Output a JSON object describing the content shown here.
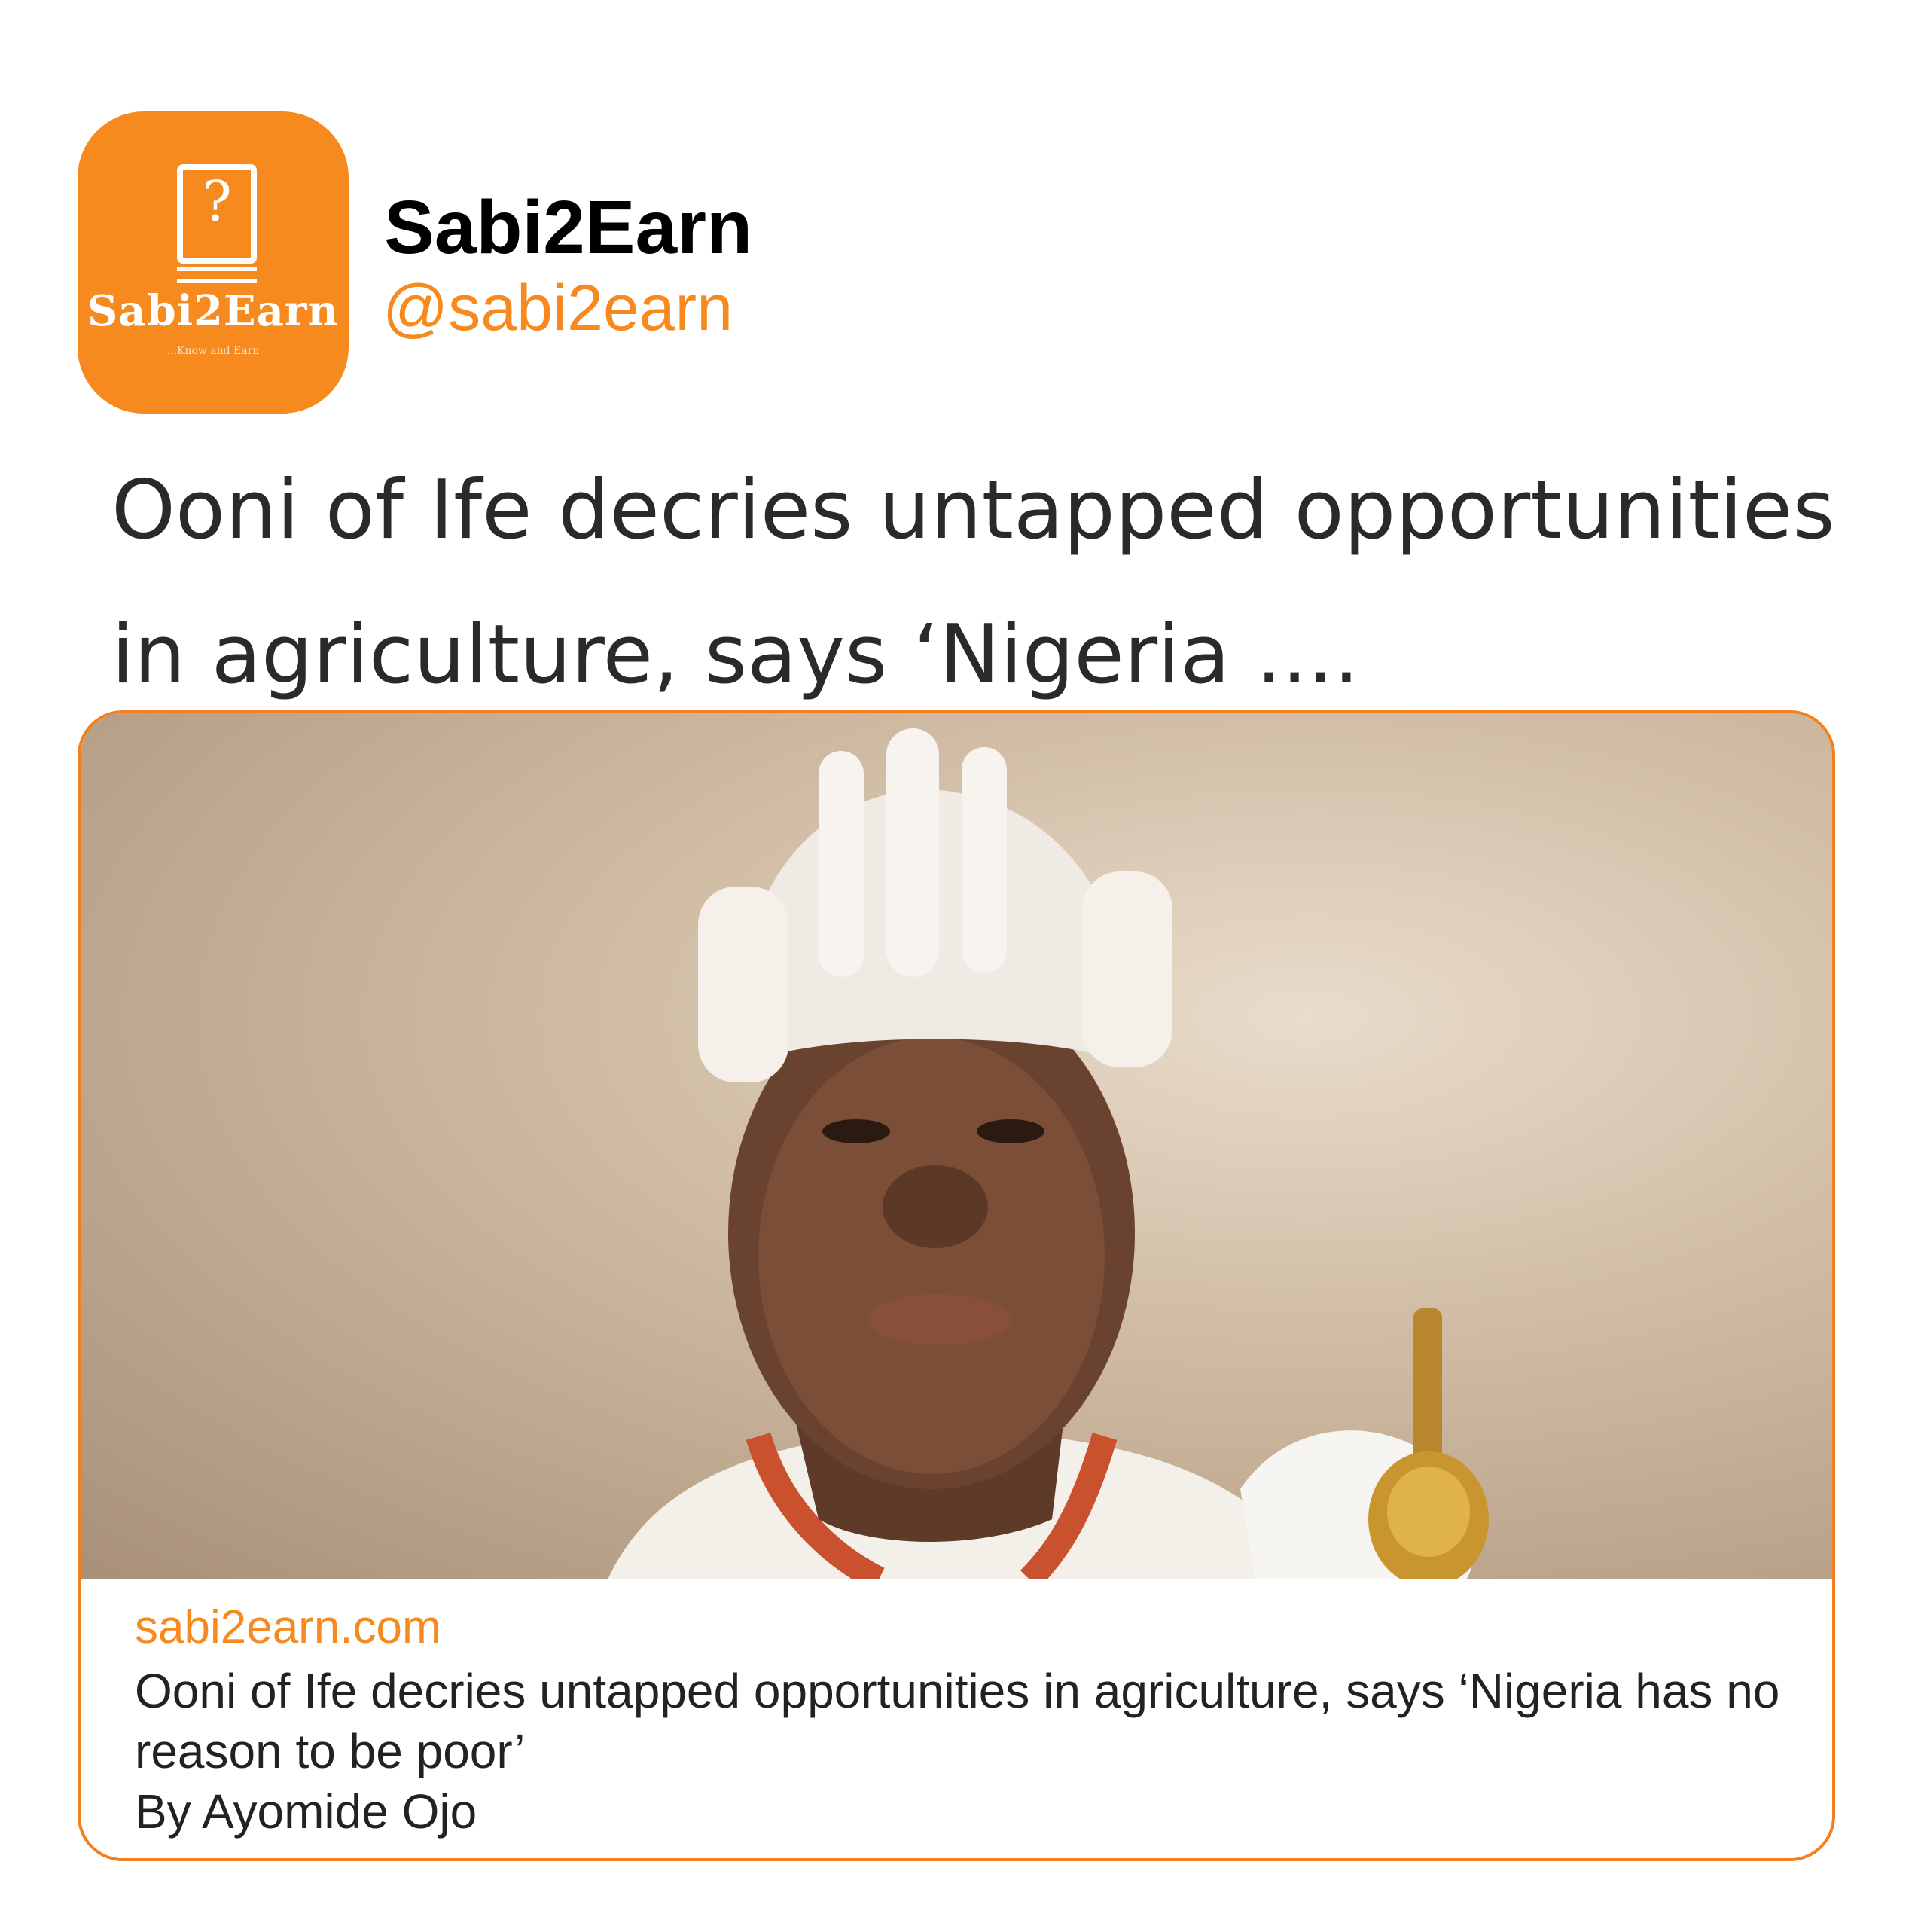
{
  "profile": {
    "name": "Sabi2Earn",
    "handle": "@sabi2earn",
    "avatar": {
      "logo_text": "Sabi2Earn",
      "tagline": "...Know and Earn",
      "icon": "book-question-icon",
      "background_color": "#f68a1f"
    }
  },
  "post": {
    "headline": "Ooni of Ife decries untapped opportunities in agriculture, says ‘Nigeria ...."
  },
  "link_card": {
    "domain": "sabi2earn.com",
    "title": "Ooni of Ife decries untapped opportunities in agriculture, says ‘Nigeria has no reason to be poor’",
    "byline": "By Ayomide Ojo",
    "border_color": "#f47f1c"
  },
  "colors": {
    "accent": "#f68a1f",
    "text": "#222222"
  }
}
